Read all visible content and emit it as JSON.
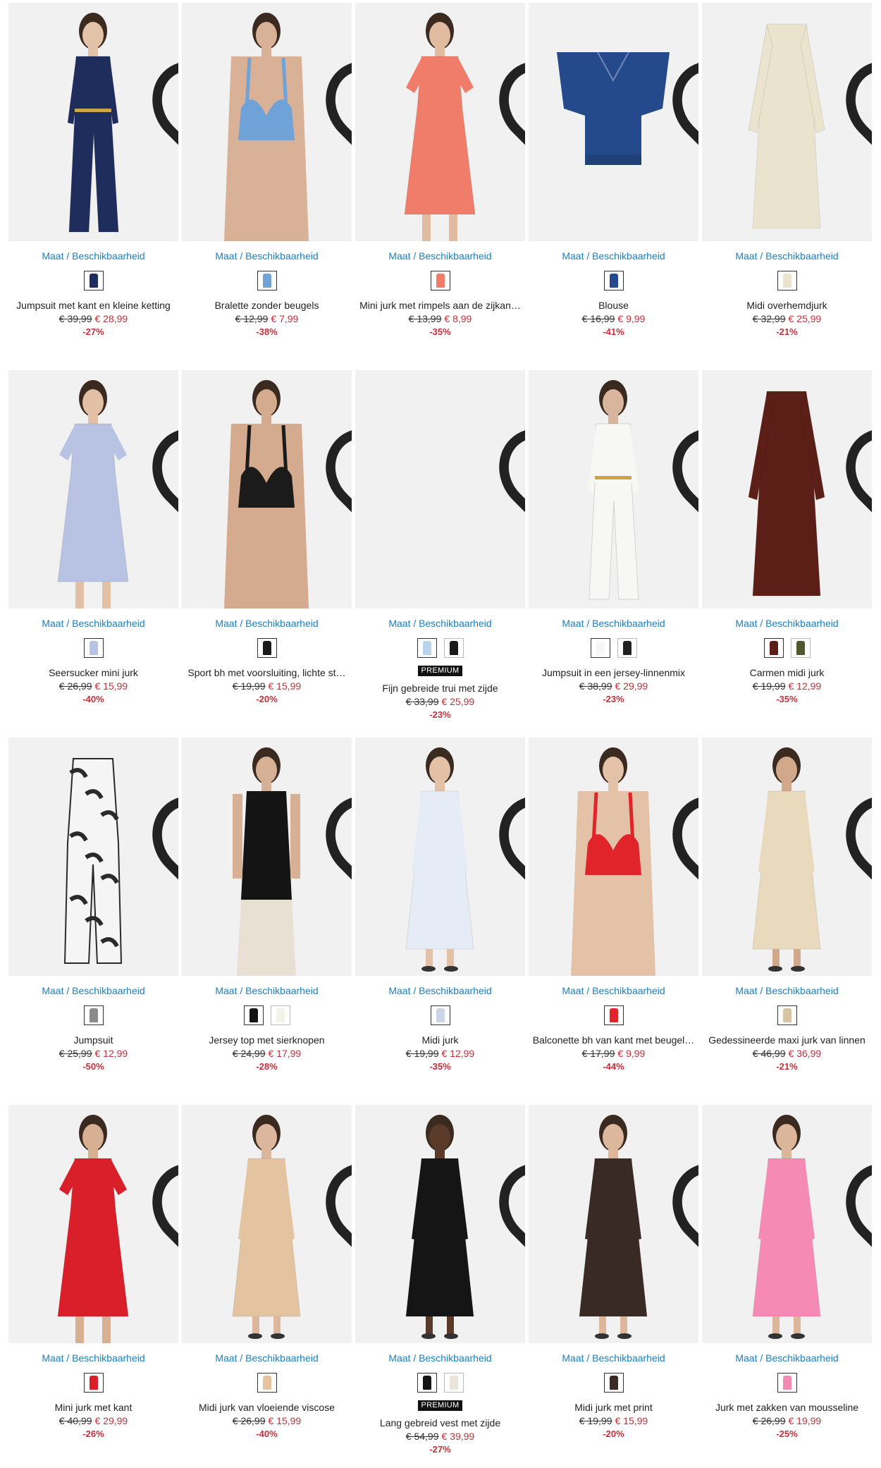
{
  "labels": {
    "size_link": "Maat / Beschikbaarheid",
    "premium": "PREMIUM",
    "wishlist_icon": "heart-outline-icon"
  },
  "colors": {
    "accent_link": "#1a7fbf",
    "sale_price": "#c0303a",
    "image_background": "#f1f1f1"
  },
  "products": [
    {
      "name": "Jumpsuit met kant en kleine ketting",
      "old_price": "€ 39,99",
      "new_price": "€ 28,99",
      "discount": "-27%",
      "premium": false,
      "garment": "jumpsuit",
      "color": "#1f2d5c",
      "skin": "#e3c3a8",
      "swatches": [
        "#1f2d5c"
      ]
    },
    {
      "name": "Bralette zonder beugels",
      "old_price": "€ 12,99",
      "new_price": "€ 7,99",
      "discount": "-38%",
      "premium": false,
      "garment": "bra",
      "color": "#6fa3d8",
      "skin": "#d9b196",
      "swatches": [
        "#6fa3d8"
      ]
    },
    {
      "name": "Mini jurk met rimpels aan de zijkan…",
      "old_price": "€ 13,99",
      "new_price": "€ 8,99",
      "discount": "-35%",
      "premium": false,
      "garment": "dress-short",
      "color": "#f07c6a",
      "skin": "#e0bba0",
      "swatches": [
        "#f07c6a"
      ]
    },
    {
      "name": "Blouse",
      "old_price": "€ 16,99",
      "new_price": "€ 9,99",
      "discount": "-41%",
      "premium": false,
      "garment": "flat-top",
      "color": "#254a8c",
      "skin": "",
      "swatches": [
        "#254a8c"
      ]
    },
    {
      "name": "Midi overhemdjurk",
      "old_price": "€ 32,99",
      "new_price": "€ 25,99",
      "discount": "-21%",
      "premium": false,
      "garment": "flat-dress",
      "color": "#eae4cf",
      "skin": "",
      "swatches": [
        "#eae4cf"
      ]
    },
    {
      "name": "Seersucker mini jurk",
      "old_price": "€ 26,99",
      "new_price": "€ 15,99",
      "discount": "-40%",
      "premium": false,
      "garment": "dress-short",
      "color": "#b8c3e3",
      "skin": "#e2c0a6",
      "swatches": [
        "#b8c3e3"
      ]
    },
    {
      "name": "Sport bh met voorsluiting, lichte st…",
      "old_price": "€ 19,99",
      "new_price": "€ 15,99",
      "discount": "-20%",
      "premium": false,
      "garment": "bra",
      "color": "#1b1b1b",
      "skin": "#d4ab8f",
      "swatches": [
        "#1b1b1b"
      ]
    },
    {
      "name": "Fijn gebreide trui met zijde",
      "old_price": "€ 33,99",
      "new_price": "€ 25,99",
      "discount": "-23%",
      "premium": true,
      "garment": "none",
      "color": "#f1f1f1",
      "skin": "",
      "swatches": [
        "#b9d4ea",
        "#1a1a1a"
      ]
    },
    {
      "name": "Jumpsuit in een jersey-linnenmix",
      "old_price": "€ 38,99",
      "new_price": "€ 29,99",
      "discount": "-23%",
      "premium": false,
      "garment": "jumpsuit",
      "color": "#f7f7f5",
      "skin": "#d8b59c",
      "swatches": [
        "#f7f7f5",
        "#222222"
      ]
    },
    {
      "name": "Carmen midi jurk",
      "old_price": "€ 19,99",
      "new_price": "€ 12,99",
      "discount": "-35%",
      "premium": false,
      "garment": "flat-dress",
      "color": "#5b1f18",
      "skin": "",
      "swatches": [
        "#5b1f18",
        "#4e5a2e"
      ]
    },
    {
      "name": "Jumpsuit",
      "old_price": "€ 25,99",
      "new_price": "€ 12,99",
      "discount": "-50%",
      "premium": false,
      "garment": "flat-jumpsuit",
      "color": "#2a2a2a",
      "skin": "",
      "swatches": [
        "#8a8a8a"
      ]
    },
    {
      "name": "Jersey top met sierknopen",
      "old_price": "€ 24,99",
      "new_price": "€ 17,99",
      "discount": "-28%",
      "premium": false,
      "garment": "top",
      "color": "#141414",
      "skin": "#d6b195",
      "swatches": [
        "#141414",
        "#f5f2ea"
      ]
    },
    {
      "name": "Midi jurk",
      "old_price": "€ 19,99",
      "new_price": "€ 12,99",
      "discount": "-35%",
      "premium": false,
      "garment": "dress-long",
      "color": "#e6ecf5",
      "skin": "#e2c1a7",
      "swatches": [
        "#c9d6e8"
      ]
    },
    {
      "name": "Balconette bh van kant met beugel…",
      "old_price": "€ 17,99",
      "new_price": "€ 9,99",
      "discount": "-44%",
      "premium": false,
      "garment": "bra",
      "color": "#e0242a",
      "skin": "#e4c2a8",
      "swatches": [
        "#e0242a"
      ]
    },
    {
      "name": "Gedessineerde maxi jurk van linnen",
      "old_price": "€ 46,99",
      "new_price": "€ 36,99",
      "discount": "-21%",
      "premium": false,
      "garment": "dress-long",
      "color": "#e9d9bd",
      "skin": "#d2a88a",
      "swatches": [
        "#d9c3a0"
      ]
    },
    {
      "name": "Mini jurk met kant",
      "old_price": "€ 40,99",
      "new_price": "€ 29,99",
      "discount": "-26%",
      "premium": false,
      "garment": "dress-short",
      "color": "#d9202a",
      "skin": "#d7b094",
      "swatches": [
        "#d9202a"
      ]
    },
    {
      "name": "Midi jurk van vloeiende viscose",
      "old_price": "€ 26,99",
      "new_price": "€ 15,99",
      "discount": "-40%",
      "premium": false,
      "garment": "dress-long",
      "color": "#e4c4a0",
      "skin": "#dcb79d",
      "swatches": [
        "#e4c4a0"
      ]
    },
    {
      "name": "Lang gebreid vest met zijde",
      "old_price": "€ 54,99",
      "new_price": "€ 39,99",
      "discount": "-27%",
      "premium": true,
      "garment": "dress-long",
      "color": "#151515",
      "skin": "#5a3a28",
      "swatches": [
        "#151515",
        "#eae5d8"
      ]
    },
    {
      "name": "Midi jurk met print",
      "old_price": "€ 19,99",
      "new_price": "€ 15,99",
      "discount": "-20%",
      "premium": false,
      "garment": "dress-long",
      "color": "#3a2a26",
      "skin": "#dcb79c",
      "swatches": [
        "#3a2a26"
      ]
    },
    {
      "name": "Jurk met zakken van mousseline",
      "old_price": "€ 26,99",
      "new_price": "€ 19,99",
      "discount": "-25%",
      "premium": false,
      "garment": "dress-long",
      "color": "#f58ab5",
      "skin": "#dbb69b",
      "swatches": [
        "#f58ab5"
      ]
    }
  ]
}
